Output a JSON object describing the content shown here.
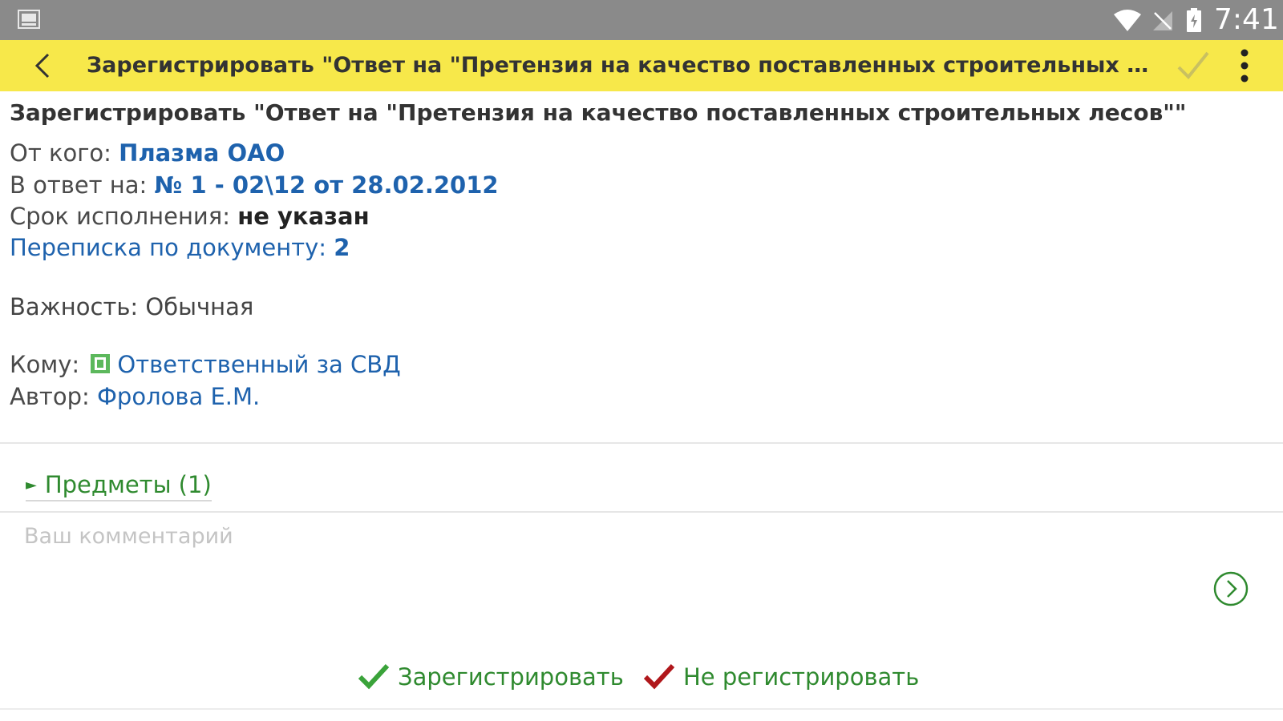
{
  "status_bar": {
    "time": "7:41",
    "icons": [
      "picture-icon",
      "wifi-icon",
      "no-signal-icon",
      "battery-icon"
    ]
  },
  "toolbar": {
    "title": "Зарегистрировать \"Ответ на \"Претензия на качество поставленных строительных лесов\"\"",
    "background": "#f7e84a"
  },
  "document": {
    "title": "Зарегистрировать \"Ответ на \"Претензия на качество поставленных строительных лесов\"\"",
    "from_label": "От кого: ",
    "from_value": "Плазма ОАО",
    "in_reply_label": "В ответ на: ",
    "in_reply_value": "№ 1 - 02\\12 от 28.02.2012",
    "deadline_label": "Срок исполнения: ",
    "deadline_value": "не указан",
    "correspondence_label": "Переписка по документу: ",
    "correspondence_count": "2",
    "importance": "Важность: Обычная",
    "to_label": "Кому: ",
    "to_value": "Ответственный за СВД",
    "author_label": "Автор: ",
    "author_value": "Фролова Е.М."
  },
  "items_section": {
    "label": "Предметы (1)"
  },
  "comment": {
    "placeholder": "Ваш комментарий",
    "value": ""
  },
  "actions": {
    "register_label": "Зарегистрировать",
    "reject_label": "Не регистрировать"
  },
  "colors": {
    "link": "#1e62ad",
    "green": "#2f8a2f",
    "reject_red": "#b0171b",
    "status_bar": "#8a8a8a"
  }
}
